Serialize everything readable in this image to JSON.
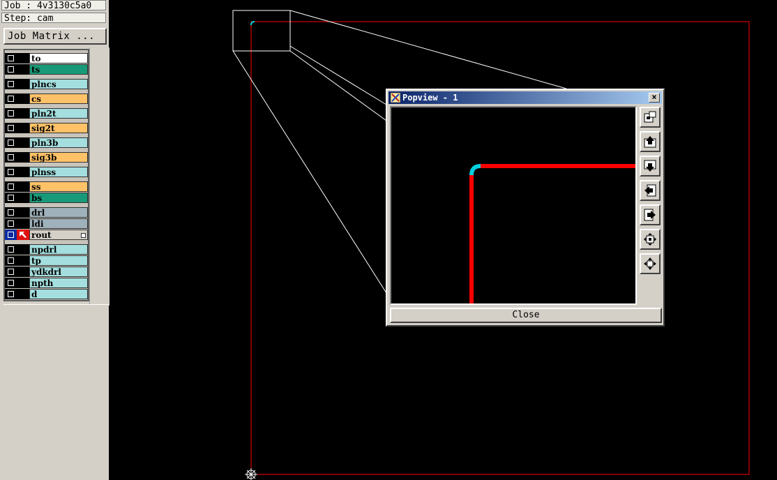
{
  "header": {
    "job": "Job : 4v3130c5a0",
    "step": "Step: cam",
    "job_matrix_button": "Job Matrix ..."
  },
  "layers": [
    {
      "name": "to",
      "color": "#ffffff",
      "row": "white"
    },
    {
      "name": "ts",
      "color": "#189a78",
      "row": "green"
    },
    {
      "name": "plncs",
      "color": "#a4dede",
      "row": "cyan"
    },
    {
      "name": "cs",
      "color": "#ffc268",
      "row": "orange"
    },
    {
      "name": "pln2t",
      "color": "#a4dede",
      "row": "cyan"
    },
    {
      "name": "sig2t",
      "color": "#ffc268",
      "row": "orange"
    },
    {
      "name": "pln3b",
      "color": "#a4dede",
      "row": "cyan"
    },
    {
      "name": "sig3b",
      "color": "#ffc268",
      "row": "orange"
    },
    {
      "name": "plnss",
      "color": "#a4dede",
      "row": "cyan"
    },
    {
      "name": "ss",
      "color": "#ffc268",
      "row": "orange"
    },
    {
      "name": "bs",
      "color": "#189a78",
      "row": "green"
    },
    {
      "name": "drl",
      "color": "#9fb2bc",
      "row": "grey"
    },
    {
      "name": "ldi",
      "color": "#9fb2bc",
      "row": "grey"
    },
    {
      "name": "rout",
      "color": "#d4d0c8",
      "row": "lightgrey",
      "active": true
    },
    {
      "name": "npdrl",
      "color": "#a4dede",
      "row": "cyan"
    },
    {
      "name": "tp",
      "color": "#a4dede",
      "row": "cyan"
    },
    {
      "name": "ydkdrl",
      "color": "#a4dede",
      "row": "cyan"
    },
    {
      "name": "npth",
      "color": "#a4dede",
      "row": "cyan"
    },
    {
      "name": "d",
      "color": "#a4dede",
      "row": "cyan"
    }
  ],
  "popview": {
    "title": "Popview - 1",
    "close_x": "×",
    "close_button": "Close",
    "tools": [
      {
        "icon": "zoom-window-icon"
      },
      {
        "icon": "pan-up-icon"
      },
      {
        "icon": "pan-down-icon"
      },
      {
        "icon": "pan-left-icon"
      },
      {
        "icon": "pan-right-icon"
      },
      {
        "icon": "zoom-out-icon"
      },
      {
        "icon": "zoom-in-icon"
      }
    ]
  },
  "colors": {
    "board_outline": "#ff0000",
    "zoom_lines": "#ffffff",
    "rout_arc": "#00d0e0",
    "rout_line": "#ff0000"
  }
}
